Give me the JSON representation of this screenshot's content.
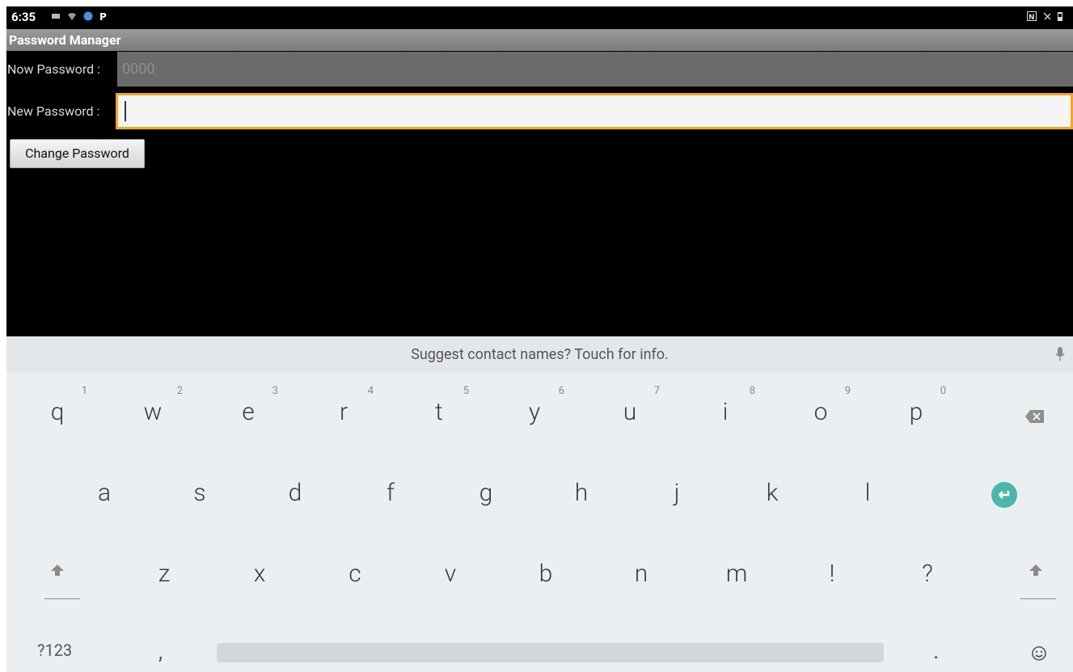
{
  "status_bar": {
    "time": "6:35",
    "icons": [
      "message-icon",
      "wifi-icon",
      "browser-icon",
      "parking-icon",
      "nfc-icon",
      "vibrate-off-icon",
      "battery-icon"
    ]
  },
  "app": {
    "title": "Password Manager",
    "now_label": "Now Password :",
    "now_value": "0000",
    "new_label": "New Password :",
    "new_value": "",
    "change_button": "Change Password"
  },
  "keyboard": {
    "suggestion": "Suggest contact names? Touch for info.",
    "row1": [
      {
        "ch": "q",
        "num": "1"
      },
      {
        "ch": "w",
        "num": "2"
      },
      {
        "ch": "e",
        "num": "3"
      },
      {
        "ch": "r",
        "num": "4"
      },
      {
        "ch": "t",
        "num": "5"
      },
      {
        "ch": "y",
        "num": "6"
      },
      {
        "ch": "u",
        "num": "7"
      },
      {
        "ch": "i",
        "num": "8"
      },
      {
        "ch": "o",
        "num": "9"
      },
      {
        "ch": "p",
        "num": "0"
      }
    ],
    "row2": [
      "a",
      "s",
      "d",
      "f",
      "g",
      "h",
      "j",
      "k",
      "l"
    ],
    "row3": [
      "z",
      "x",
      "c",
      "v",
      "b",
      "n",
      "m",
      "!",
      "?"
    ],
    "symbols_key": "?123",
    "comma_key": ",",
    "period_key": ".",
    "accent_color": "#4db6ac"
  }
}
